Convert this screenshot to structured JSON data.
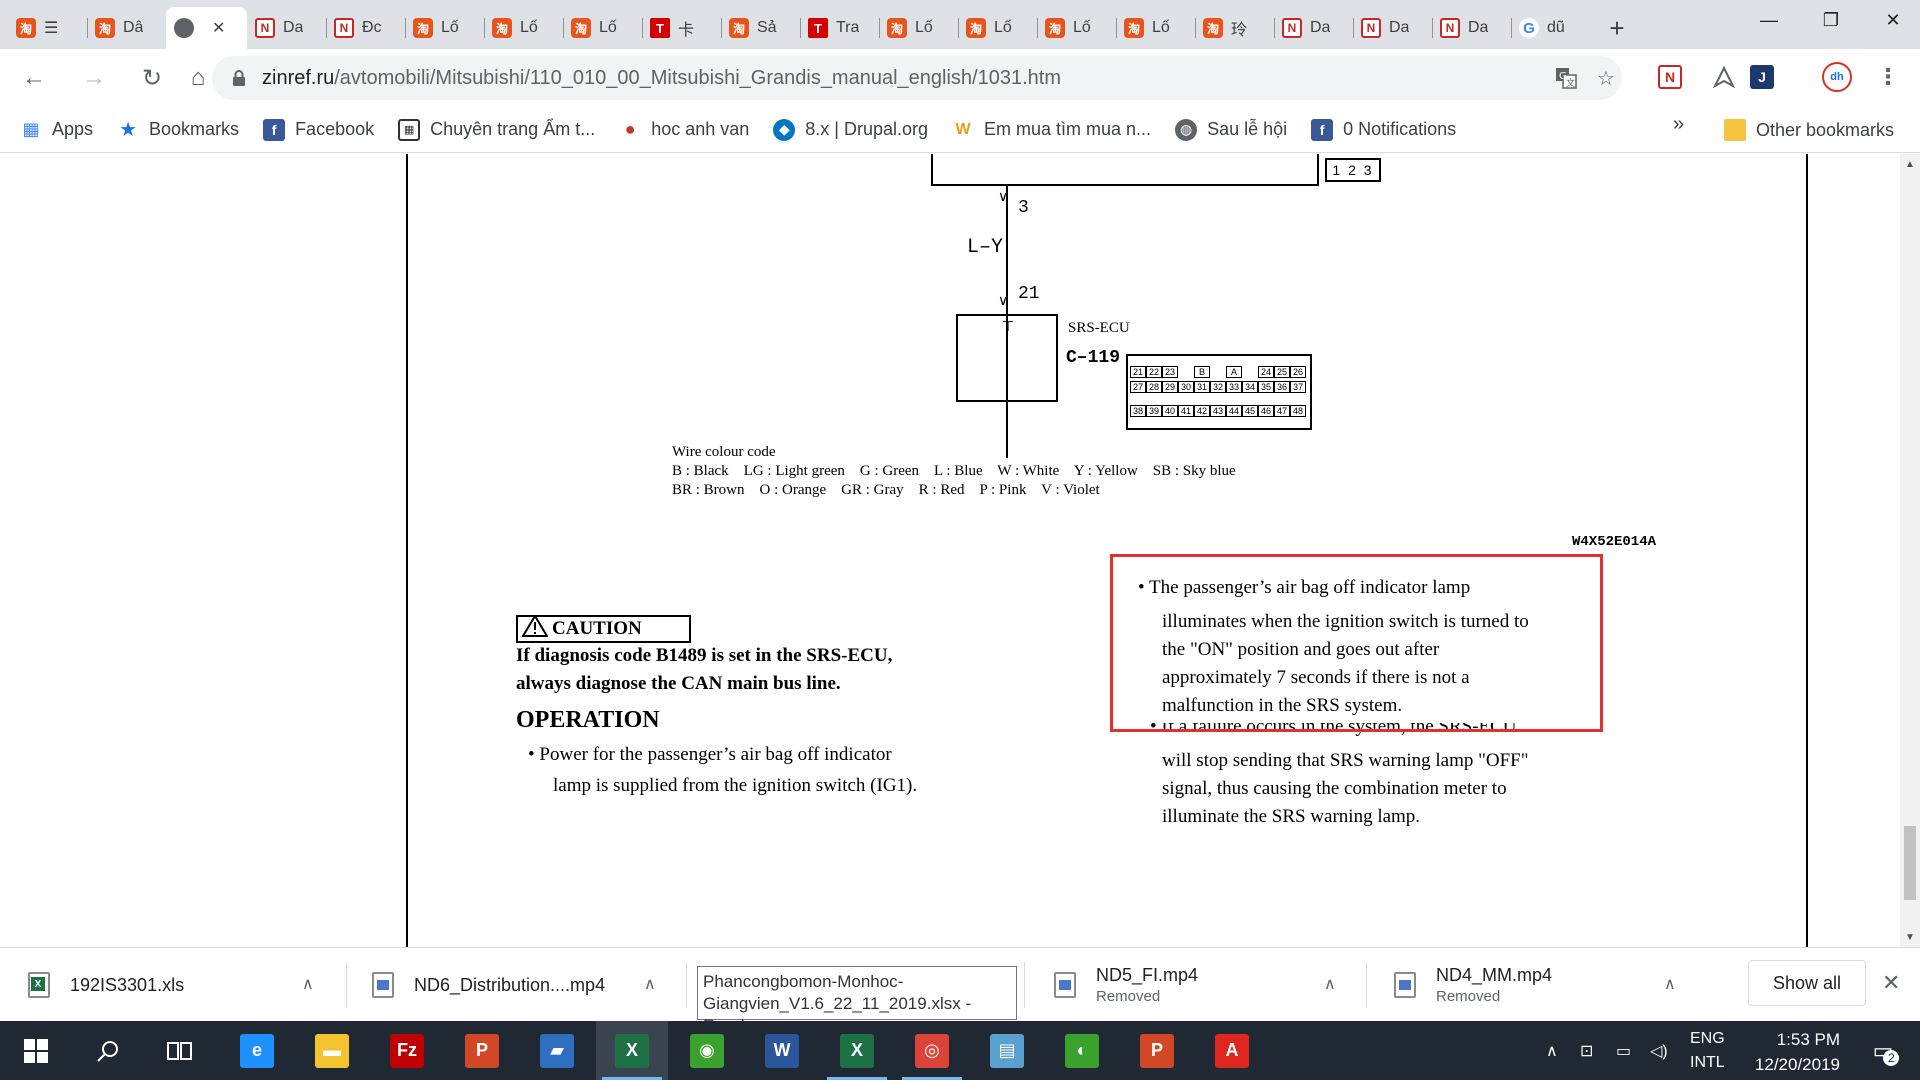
{
  "browser": {
    "tabs": [
      {
        "favicon": "taobao-icon",
        "glyph": "淘",
        "title": "☰",
        "kind": "tb"
      },
      {
        "favicon": "taobao-icon",
        "glyph": "淘",
        "title": "Dâ",
        "kind": "tb"
      },
      {
        "favicon": "globe-icon",
        "glyph": "",
        "title": "",
        "kind": "globe",
        "active": true,
        "close": "✕"
      },
      {
        "favicon": "n-logo-icon",
        "glyph": "N",
        "title": "Da",
        "kind": "n"
      },
      {
        "favicon": "n-logo-icon",
        "glyph": "N",
        "title": "Đc",
        "kind": "n"
      },
      {
        "favicon": "taobao-icon",
        "glyph": "淘",
        "title": "Lố",
        "kind": "tb"
      },
      {
        "favicon": "taobao-icon",
        "glyph": "淘",
        "title": "Lố",
        "kind": "tb"
      },
      {
        "favicon": "taobao-icon",
        "glyph": "淘",
        "title": "Lố",
        "kind": "tb"
      },
      {
        "favicon": "t-logo-icon",
        "glyph": "T",
        "title": "卡",
        "kind": "t"
      },
      {
        "favicon": "taobao-icon",
        "glyph": "淘",
        "title": "Sả",
        "kind": "tb"
      },
      {
        "favicon": "t-logo-icon",
        "glyph": "T",
        "title": "Tra",
        "kind": "t"
      },
      {
        "favicon": "taobao-icon",
        "glyph": "淘",
        "title": "Lố",
        "kind": "tb"
      },
      {
        "favicon": "taobao-icon",
        "glyph": "淘",
        "title": "Lố",
        "kind": "tb"
      },
      {
        "favicon": "taobao-icon",
        "glyph": "淘",
        "title": "Lố",
        "kind": "tb"
      },
      {
        "favicon": "taobao-icon",
        "glyph": "淘",
        "title": "Lố",
        "kind": "tb"
      },
      {
        "favicon": "taobao-icon",
        "glyph": "淘",
        "title": "玲",
        "kind": "tb"
      },
      {
        "favicon": "n-logo-icon",
        "glyph": "N",
        "title": "Da",
        "kind": "n"
      },
      {
        "favicon": "n-logo-icon",
        "glyph": "N",
        "title": "Da",
        "kind": "n"
      },
      {
        "favicon": "n-logo-icon",
        "glyph": "N",
        "title": "Da",
        "kind": "n"
      },
      {
        "favicon": "google-icon",
        "glyph": "G",
        "title": "dũ",
        "kind": "g"
      }
    ],
    "new_tab": "+",
    "window_controls": {
      "minimize": "—",
      "restore": "❐",
      "close": "✕"
    },
    "url_host": "zinref.ru",
    "url_path": "/avtomobili/Mitsubishi/110_010_00_Mitsubishi_Grandis_manual_english/1031.htm",
    "bookmarks": [
      {
        "icon": "apps-grid-icon",
        "label": "Apps"
      },
      {
        "icon": "star-icon",
        "label": "Bookmarks"
      },
      {
        "icon": "facebook-icon",
        "label": "Facebook"
      },
      {
        "icon": "grid-site-icon",
        "label": "Chuyên trang Ẩm t..."
      },
      {
        "icon": "speech-bubble-icon",
        "label": "hoc anh van"
      },
      {
        "icon": "drupal-icon",
        "label": "8.x | Drupal.org"
      },
      {
        "icon": "w-logo-icon",
        "label": "Em mua tìm mua n..."
      },
      {
        "icon": "globe-icon",
        "label": "Sau lễ hội"
      },
      {
        "icon": "facebook-icon",
        "label": "0 Notifications"
      }
    ],
    "bookmarks_more": "»",
    "other_bookmarks": "Other bookmarks"
  },
  "manual": {
    "connector_top_pins": "1 2 3",
    "wire_pin_top": "3",
    "wire_color": "L–Y",
    "wire_pin_bottom": "21",
    "ecu_name": "SRS-ECU",
    "connector_id": "C–119",
    "ecu_pins_row1": [
      "21",
      "22",
      "23",
      "",
      "B",
      "",
      "A",
      "",
      "24",
      "25",
      "26"
    ],
    "ecu_pins_row2": [
      "27",
      "28",
      "29",
      "30",
      "31",
      "32",
      "33",
      "34",
      "35",
      "36",
      "37"
    ],
    "ecu_pins_row3": [
      "38",
      "39",
      "40",
      "41",
      "42",
      "43",
      "44",
      "45",
      "46",
      "47",
      "48"
    ],
    "wire_code_title": "Wire colour code",
    "wire_code_line1": "B : Black    LG : Light green    G : Green    L : Blue    W : White    Y : Yellow    SB : Sky blue",
    "wire_code_line2": "BR : Brown    O : Orange    GR : Gray    R : Red    P : Pink    V : Violet",
    "figure_code": "W4X52E014A",
    "caution_label": "CAUTION",
    "caution_text_1": "If diagnosis code B1489 is set in the SRS-ECU,",
    "caution_text_2": "always diagnose the CAN main bus line.",
    "operation_heading": "OPERATION",
    "operation_bullet_1a": "• Power for the passenger’s air bag off indicator",
    "operation_bullet_1b": "lamp is supplied from the ignition switch (IG1).",
    "right_bullet_1a": "• The passenger’s air bag off indicator lamp",
    "right_bullet_1b": "illuminates when the ignition switch is turned to",
    "right_bullet_1c": "the \"ON\" position and goes out after",
    "right_bullet_1d": "approximately 7 seconds if there is not a",
    "right_bullet_1e": "malfunction in the SRS system.",
    "right_bullet_2a": "• If a failure occurs in the system, the SRS-ECU",
    "right_bullet_2b": "will stop sending that SRS warning lamp \"OFF\"",
    "right_bullet_2c": "signal, thus causing the combination meter to",
    "right_bullet_2d": "illuminate the SRS warning lamp."
  },
  "downloads": {
    "items": [
      {
        "name": "192IS3301.xls",
        "sub": "",
        "type": "xls"
      },
      {
        "name": "ND6_Distribution....mp4",
        "sub": "",
        "type": "vid"
      },
      {
        "name": "",
        "sub": "",
        "type": "xls"
      },
      {
        "name": "ND5_FI.mp4",
        "sub": "Removed",
        "type": "vid"
      },
      {
        "name": "ND4_MM.mp4",
        "sub": "Removed",
        "type": "vid"
      }
    ],
    "tooltip": "Phancongbomon-Monhoc-Giangvien_V1.6_22_11_2019.xlsx - Excel",
    "show_all": "Show all",
    "close": "✕",
    "chevron": "∧"
  },
  "taskbar": {
    "start": "⊞",
    "search": "⌕",
    "taskview": "⧉",
    "apps": [
      {
        "name": "edge-icon",
        "glyph": "e",
        "color": "#1e90ff"
      },
      {
        "name": "file-explorer-icon",
        "glyph": "▬",
        "color": "#f4c430"
      },
      {
        "name": "filezilla-icon",
        "glyph": "Fz",
        "color": "#bf0000"
      },
      {
        "name": "powerpoint-icon",
        "glyph": "P",
        "color": "#d24726"
      },
      {
        "name": "sticky-app-icon",
        "glyph": "▰",
        "color": "#2f6fbf"
      },
      {
        "name": "excel-icon",
        "glyph": "X",
        "color": "#1e7145"
      },
      {
        "name": "camtasia-icon",
        "glyph": "◉",
        "color": "#3aa12d"
      },
      {
        "name": "word-icon",
        "glyph": "W",
        "color": "#2b579a"
      },
      {
        "name": "excel-icon",
        "glyph": "X",
        "color": "#1e7145"
      },
      {
        "name": "chrome-icon",
        "glyph": "◎",
        "color": "#db4437"
      },
      {
        "name": "notepad-icon",
        "glyph": "▤",
        "color": "#5aa0d0"
      },
      {
        "name": "maps-app-icon",
        "glyph": "◐",
        "color": "#3aa12d"
      },
      {
        "name": "powerpoint-icon",
        "glyph": "P",
        "color": "#d24726"
      },
      {
        "name": "pdf-tool-icon",
        "glyph": "A",
        "color": "#e0271f"
      }
    ],
    "lang_top": "ENG",
    "lang_bottom": "INTL",
    "time": "1:53 PM",
    "date": "12/20/2019",
    "notifications": "2"
  }
}
